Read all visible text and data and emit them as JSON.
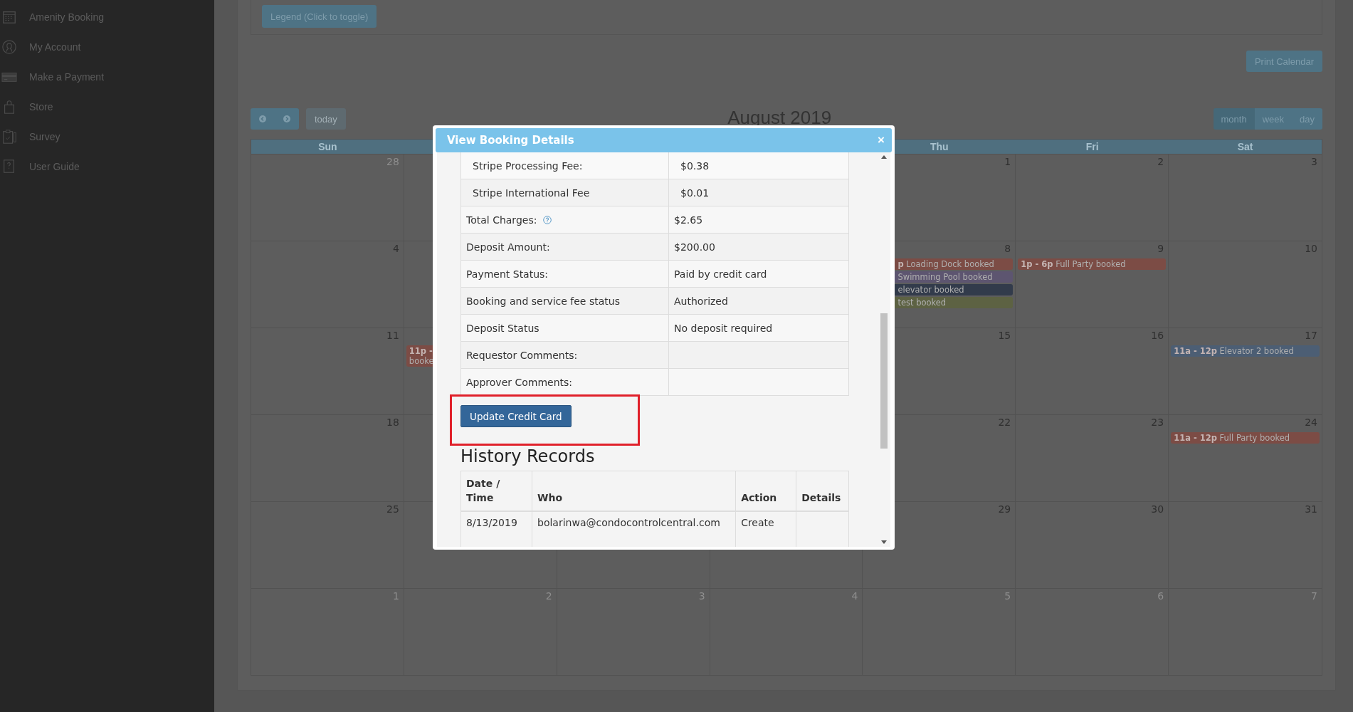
{
  "sidebar": {
    "items": [
      {
        "label": "Amenity Booking",
        "kind": "calendar"
      },
      {
        "label": "My Account",
        "kind": "person"
      },
      {
        "label": "Make a Payment",
        "kind": "card"
      },
      {
        "label": "Store",
        "kind": "bag"
      },
      {
        "label": "Survey",
        "kind": "clipboard"
      },
      {
        "label": "User Guide",
        "kind": "guide"
      }
    ]
  },
  "legend_button": "Legend (Click to toggle)",
  "print_button": "Print Calendar",
  "calendar": {
    "today_button": "today",
    "title": "August 2019",
    "views": [
      {
        "label": "month",
        "selected": true
      },
      {
        "label": "week",
        "selected": false
      },
      {
        "label": "day",
        "selected": false
      }
    ],
    "weekdays": [
      {
        "label": "Sun",
        "kind": "sun"
      },
      {
        "label": "Thu",
        "kind": "thu"
      },
      {
        "label": "Fri",
        "kind": "fri"
      },
      {
        "label": "Sat",
        "kind": "sat"
      }
    ],
    "weeks": [
      [
        {
          "kind": "sun",
          "date": "28",
          "other_month": true
        },
        {
          "kind": "thu",
          "date": "1",
          "other_month": false
        },
        {
          "kind": "fri",
          "date": "2",
          "other_month": false
        },
        {
          "kind": "sat",
          "date": "3",
          "other_month": false
        }
      ],
      [
        {
          "kind": "sun",
          "date": "4",
          "other_month": false
        },
        {
          "kind": "thu",
          "date": "8",
          "other_month": false,
          "events": [
            {
              "time": "p",
              "title": "Loading Dock booked",
              "color": "#7c4c45",
              "under_modal": true
            },
            {
              "title": "Swimming Pool booked",
              "color": "#5d5570",
              "under_modal": true
            },
            {
              "title": "elevator booked",
              "color": "#323b4b",
              "under_modal": true
            },
            {
              "title": "test booked",
              "color": "#5d6243",
              "under_modal": true
            }
          ]
        },
        {
          "kind": "fri",
          "date": "9",
          "other_month": false,
          "events": [
            {
              "time": "1p - 6p",
              "title": "Full Party booked",
              "color": "#7c4c45",
              "under_modal": false
            }
          ]
        },
        {
          "kind": "sat",
          "date": "10",
          "other_month": false
        }
      ],
      [
        {
          "kind": "sun",
          "date": "11",
          "other_month": false
        },
        {
          "kind": "mon",
          "events": [
            {
              "time": "11p -",
              "title": "booke",
              "color": "#7c4c45",
              "under_modal": false,
              "stacked": true
            }
          ]
        },
        {
          "kind": "thu",
          "date": "15",
          "other_month": false
        },
        {
          "kind": "fri",
          "date": "16",
          "other_month": false
        },
        {
          "kind": "sat",
          "date": "17",
          "other_month": false,
          "events": [
            {
              "time": "11a - 12p",
              "title": "Elevator 2 booked",
              "color": "#4c5e74",
              "under_modal": false
            }
          ]
        }
      ],
      [
        {
          "kind": "sun",
          "date": "18",
          "other_month": false
        },
        {
          "kind": "thu",
          "date": "22",
          "other_month": false
        },
        {
          "kind": "fri",
          "date": "23",
          "other_month": false
        },
        {
          "kind": "sat",
          "date": "24",
          "other_month": false,
          "events": [
            {
              "time": "11a - 12p",
              "title": "Full Party booked",
              "color": "#7c4c45",
              "under_modal": false
            }
          ]
        }
      ],
      [
        {
          "kind": "sun",
          "date": "25",
          "other_month": false
        },
        {
          "kind": "thu",
          "date": "29",
          "other_month": false
        },
        {
          "kind": "fri",
          "date": "30",
          "other_month": false
        },
        {
          "kind": "sat",
          "date": "31",
          "other_month": false
        }
      ],
      [
        {
          "kind": "sun",
          "date": "1",
          "other_month": true
        },
        {
          "kind": "mon",
          "date": "2",
          "other_month": true
        },
        {
          "kind": "tue",
          "date": "3",
          "other_month": true
        },
        {
          "kind": "wed",
          "date": "4",
          "other_month": true
        },
        {
          "kind": "thu",
          "date": "5",
          "other_month": true
        },
        {
          "kind": "fri",
          "date": "6",
          "other_month": true
        },
        {
          "kind": "sat",
          "date": "7",
          "other_month": true
        }
      ]
    ]
  },
  "modal": {
    "title": "View Booking Details",
    "close": "×",
    "details": [
      {
        "label": "Stripe Processing Fee:",
        "value": "$0.38",
        "indent": true
      },
      {
        "label": "Stripe International Fee",
        "value": "$0.01",
        "indent": true
      },
      {
        "label": "Total Charges:",
        "value": "$2.65",
        "help": true
      },
      {
        "label": "Deposit Amount:",
        "value": "$200.00"
      },
      {
        "label": "Payment Status:",
        "value": "Paid by credit card"
      },
      {
        "label": "Booking and service fee status",
        "value": "Authorized"
      },
      {
        "label": "Deposit Status",
        "value": "No deposit required"
      },
      {
        "label": "Requestor Comments:"
      },
      {
        "label": "Approver Comments:"
      }
    ],
    "update_button": "Update Credit Card",
    "highlighted": true,
    "history": {
      "title": "History Records",
      "columns": [
        "Date / Time",
        "Who",
        "Action",
        "Details"
      ],
      "rows": [
        {
          "date": "8/13/2019",
          "who": "bolarinwa@condocontrolcentral.com",
          "action": "Create"
        }
      ]
    }
  }
}
